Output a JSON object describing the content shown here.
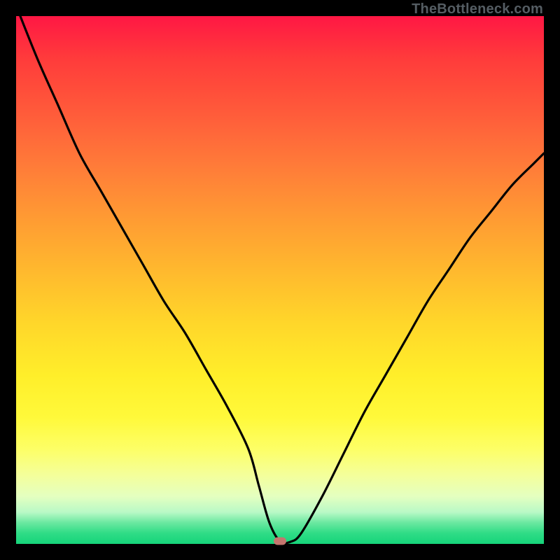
{
  "header": {
    "watermark": "TheBottleneck.com"
  },
  "chart_data": {
    "type": "line",
    "title": "",
    "xlabel": "",
    "ylabel": "",
    "xlim": [
      0,
      100
    ],
    "ylim": [
      0,
      100
    ],
    "grid": false,
    "x": [
      0,
      4,
      8,
      12,
      16,
      20,
      24,
      28,
      32,
      36,
      40,
      44,
      46,
      48,
      50,
      52,
      54,
      58,
      62,
      66,
      70,
      74,
      78,
      82,
      86,
      90,
      94,
      98,
      100
    ],
    "values": [
      102,
      92,
      83,
      74,
      67,
      60,
      53,
      46,
      40,
      33,
      26,
      18,
      11,
      4,
      0.5,
      0.4,
      2,
      9,
      17,
      25,
      32,
      39,
      46,
      52,
      58,
      63,
      68,
      72,
      74
    ],
    "marker": {
      "x": 50,
      "y": 0.5
    },
    "background": {
      "top_color": "#ff1744",
      "mid_color": "#ffee2a",
      "bottom_color": "#16d47a"
    },
    "annotations": [
      "TheBottleneck.com"
    ]
  }
}
